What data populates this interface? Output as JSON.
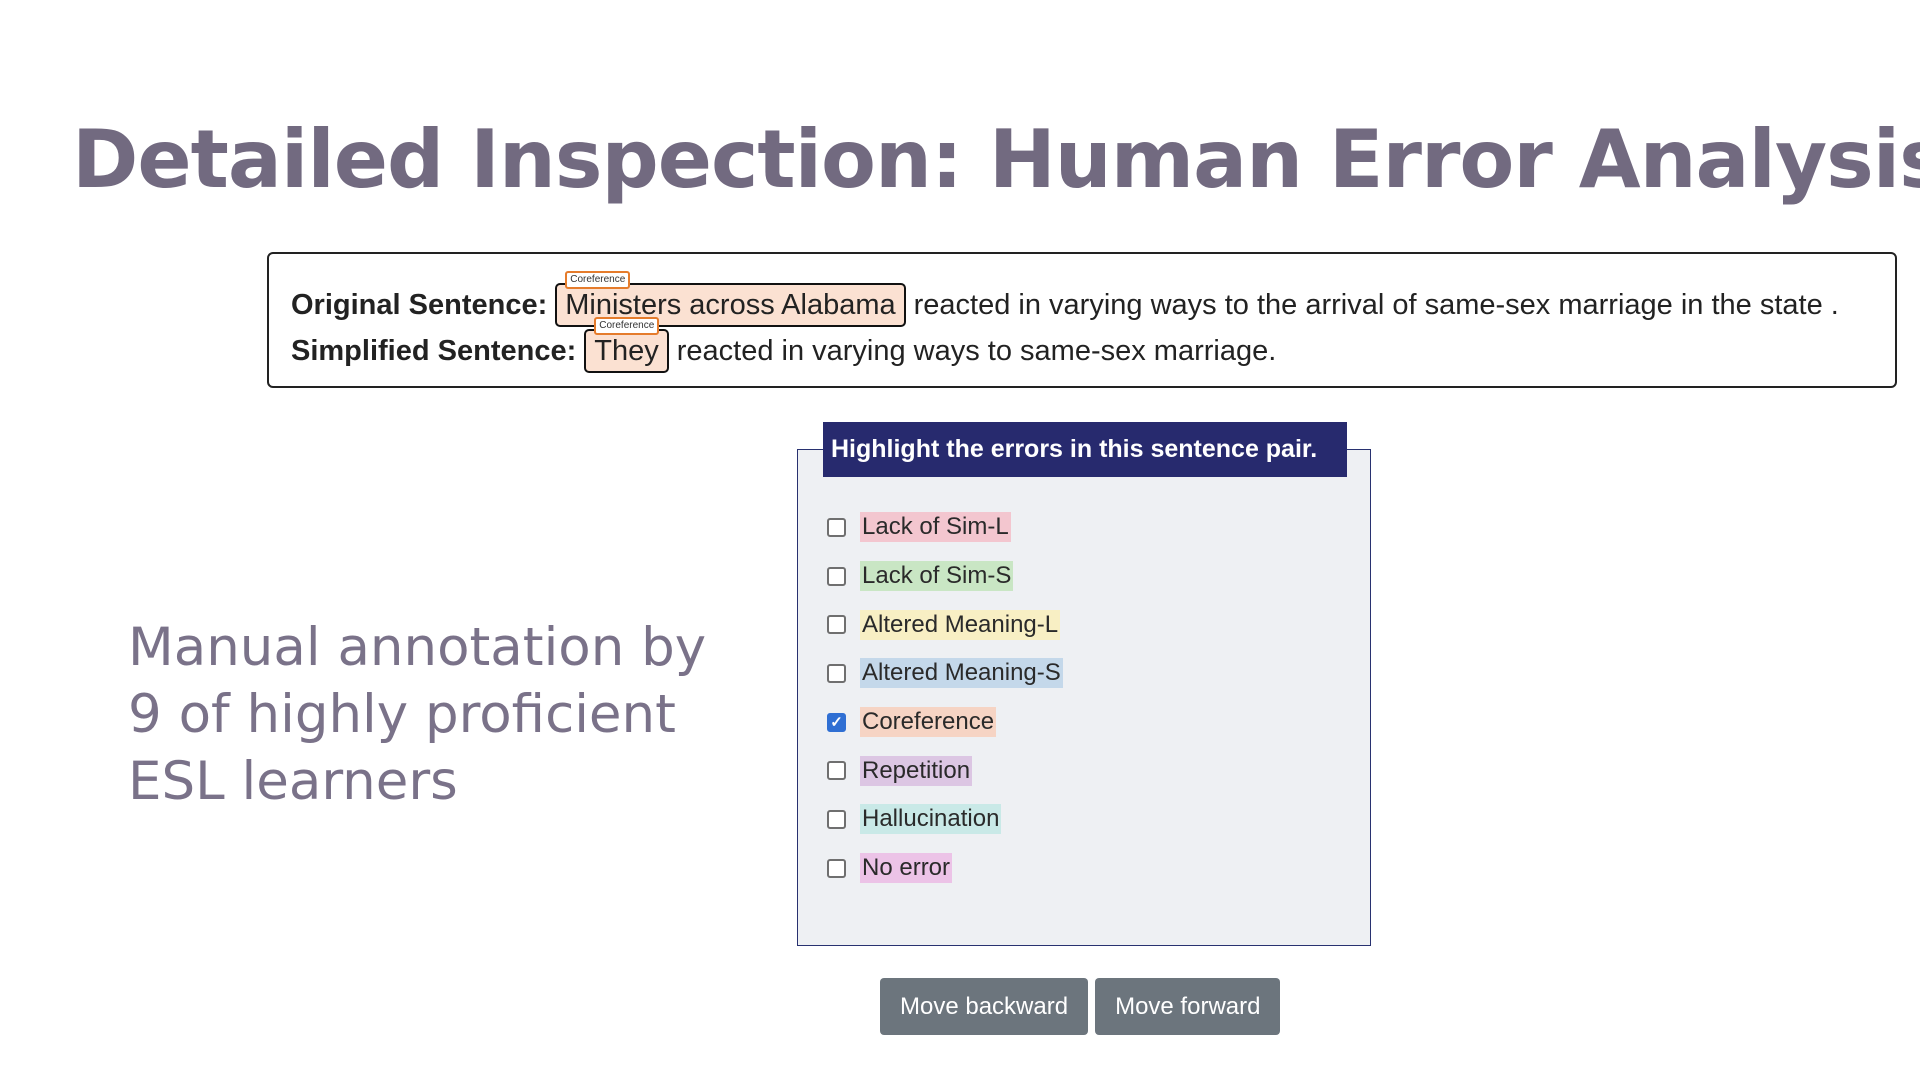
{
  "title": "Detailed Inspection: Human Error Analysis",
  "sentences": {
    "original": {
      "label": "Original Sentence:",
      "highlight": "Ministers across Alabama",
      "tag": "Coreference",
      "rest": "reacted in varying ways to the arrival of same-sex marriage in the state ."
    },
    "simplified": {
      "label": "Simplified Sentence:",
      "highlight": "They",
      "tag": "Coreference",
      "rest": "reacted in varying ways to same-sex marriage."
    }
  },
  "side_note": {
    "lines": [
      "Manual annotation by",
      "9 of highly proficient",
      "ESL learners"
    ]
  },
  "panel": {
    "header": "Highlight the errors in this sentence pair.",
    "options": [
      {
        "label": "Lack of Sim-L",
        "checked": false,
        "color": "#f3c6cf"
      },
      {
        "label": "Lack of Sim-S",
        "checked": false,
        "color": "#c9e6c4"
      },
      {
        "label": "Altered Meaning-L",
        "checked": false,
        "color": "#f8efc4"
      },
      {
        "label": "Altered Meaning-S",
        "checked": false,
        "color": "#c4d8ea"
      },
      {
        "label": "Coreference",
        "checked": true,
        "color": "#f6d4c4"
      },
      {
        "label": "Repetition",
        "checked": false,
        "color": "#dcc6e3"
      },
      {
        "label": "Hallucination",
        "checked": false,
        "color": "#c9e9e7"
      },
      {
        "label": "No error",
        "checked": false,
        "color": "#ecc3e7"
      }
    ]
  },
  "buttons": {
    "back": "Move backward",
    "forward": "Move forward"
  }
}
